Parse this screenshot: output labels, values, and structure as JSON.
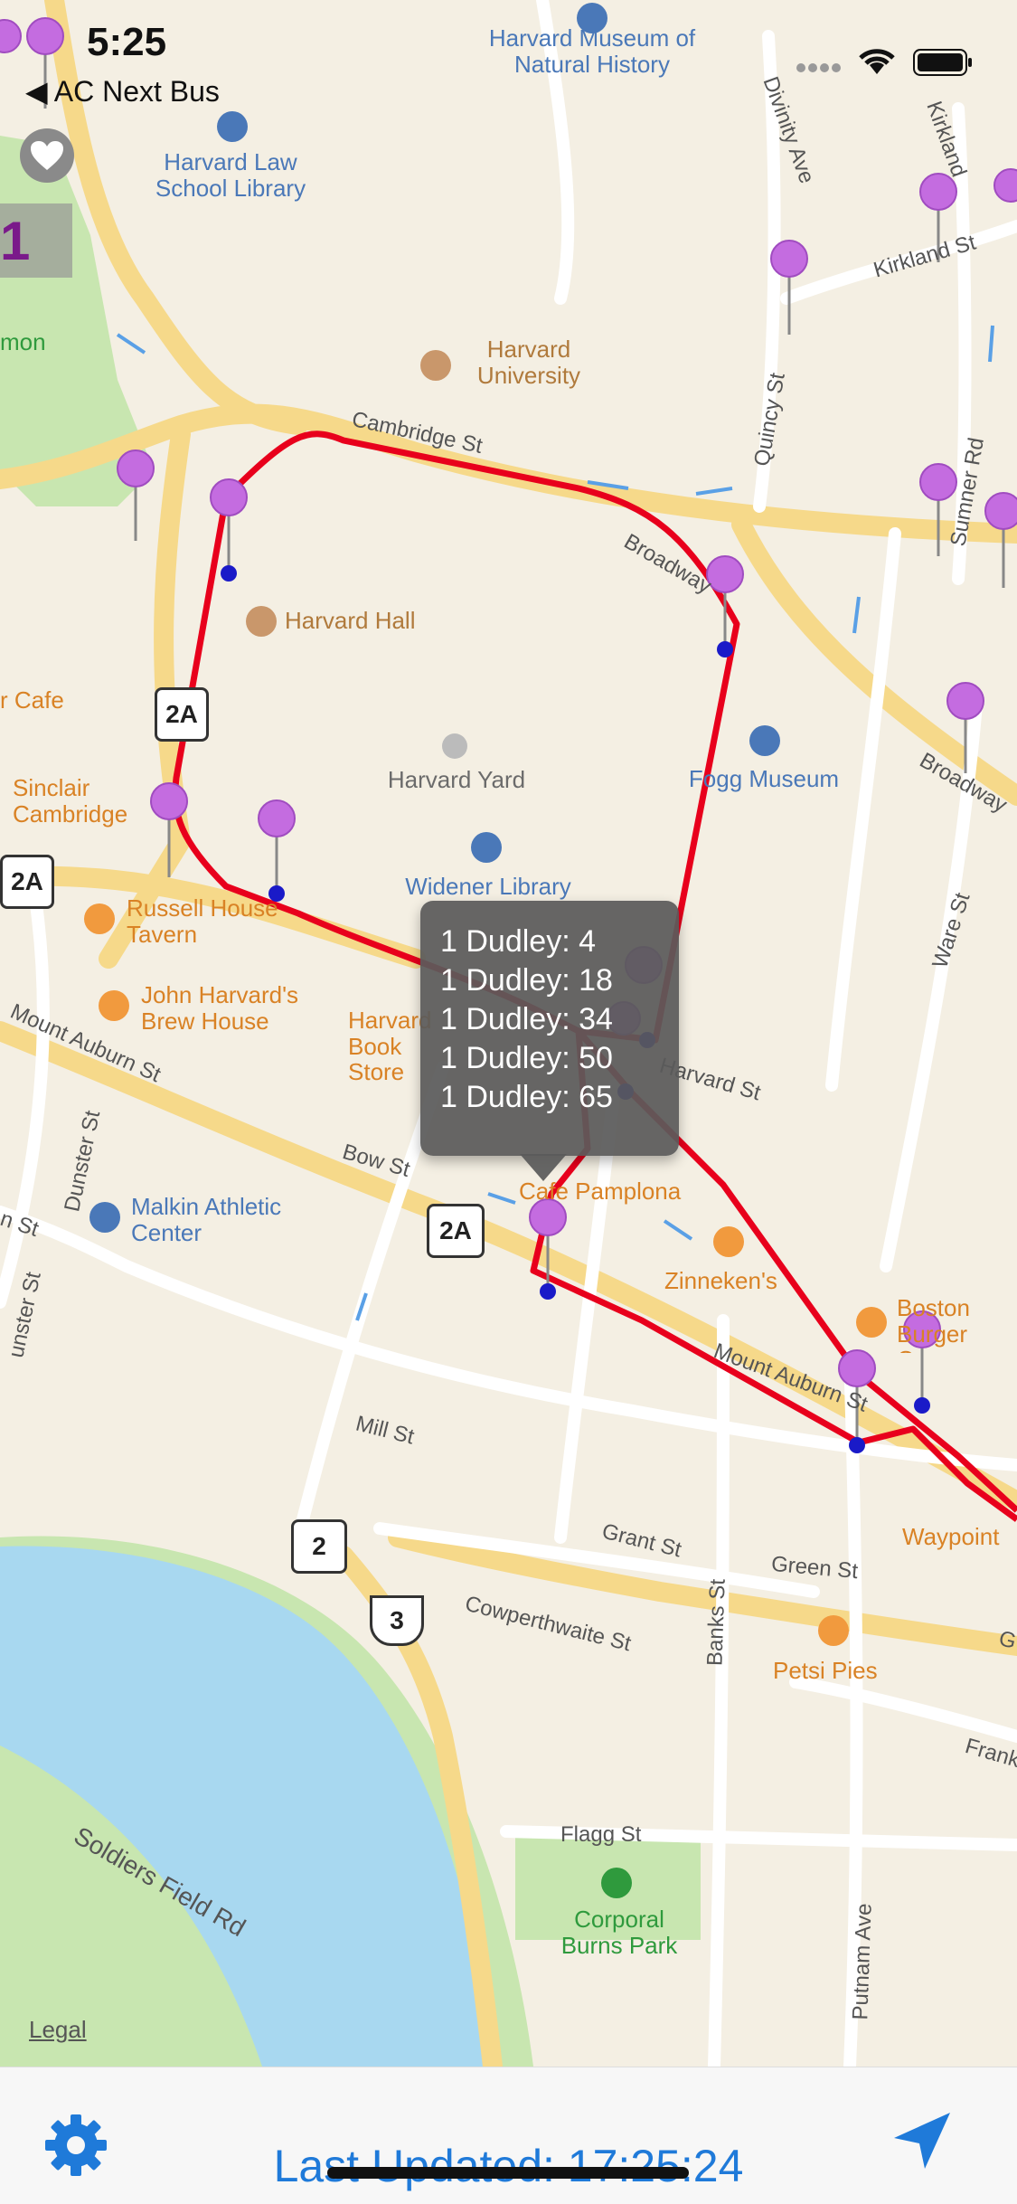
{
  "status_bar": {
    "time": "5:25"
  },
  "nav": {
    "back_label": "◀ AC Next Bus",
    "route_badge": "1"
  },
  "map": {
    "pois": {
      "harvard_museum": "Harvard Museum of Natural History",
      "harvard_law": "Harvard Law School Library",
      "harvard_university": "Harvard University",
      "harvard_hall": "Harvard Hall",
      "harvard_yard": "Harvard Yard",
      "fogg_museum": "Fogg Museum",
      "widener_library": "Widener Library",
      "sinclair": "Sinclair Cambridge",
      "russell_house": "Russell House Tavern",
      "john_harvards": "John Harvard's Brew House",
      "harvard_book_store": "Harvard Book Store",
      "cafe_pamplona": "Cafe Pamplona",
      "zinnekens": "Zinneken's",
      "boston_burger": "Boston Burger Company",
      "malkin": "Malkin Athletic Center",
      "petsi": "Petsi Pies",
      "corporal_burns": "Corporal Burns Park",
      "waypoint": "Waypoint",
      "cafe_partial": "r Cafe",
      "common_partial": "mon"
    },
    "streets": {
      "cambridge": "Cambridge St",
      "kirkland": "Kirkland St",
      "kirkland_v": "Kirkland",
      "divinity": "Divinity Ave",
      "quincy": "Quincy St",
      "sumner": "Sumner Rd",
      "broadway": "Broadway",
      "broadway2": "Broadway",
      "ware": "Ware St",
      "mount_auburn": "Mount Auburn St",
      "mount_auburn2": "Mount Auburn St",
      "harvard_st": "Harvard St",
      "bow": "Bow St",
      "dunster": "Dunster St",
      "dunster2": "unster St",
      "mill": "Mill St",
      "grant": "Grant St",
      "green": "Green St",
      "banks": "Banks St",
      "cowperthwaite": "Cowperthwaite St",
      "frank": "Frank",
      "g_partial": "G",
      "flagg": "Flagg St",
      "putnam": "Putnam Ave",
      "soldiers": "Soldiers Field Rd",
      "n_st": "n St"
    },
    "shields": {
      "r2a_a": "2A",
      "r2a_b": "2A",
      "r2a_c": "2A",
      "r2": "2",
      "r3": "3"
    },
    "legal": "Legal"
  },
  "popup": {
    "items": [
      "1 Dudley: 4",
      "1 Dudley: 18",
      "1 Dudley: 34",
      "1 Dudley: 50",
      "1 Dudley: 65"
    ]
  },
  "toolbar": {
    "last_updated": "Last Updated: 17:25:24"
  },
  "colors": {
    "route": "#e8001c",
    "pin": "#c46ce0",
    "stop": "#1a1ac8",
    "water": "#a8d8f0",
    "park": "#c8e6b0",
    "accent": "#1f7ad9"
  },
  "icons": [
    "heart-icon",
    "gear-icon",
    "location-arrow-icon",
    "pin-icon"
  ]
}
